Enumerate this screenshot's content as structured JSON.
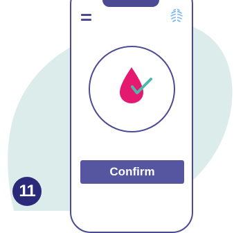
{
  "header": {
    "menu_icon": "hamburger-menu-icon",
    "logo_icon": "fingerprint-logo-icon"
  },
  "status": {
    "icon": "blood-drop-check-icon"
  },
  "actions": {
    "confirm_label": "Confirm"
  },
  "step": {
    "number": "11"
  },
  "colors": {
    "background_blob": "#dcecea",
    "phone_outline": "#4b4a92",
    "button": "#5555a0",
    "drop": "#e5196f",
    "check": "#4fb8ac",
    "badge": "#2b2a7a"
  }
}
